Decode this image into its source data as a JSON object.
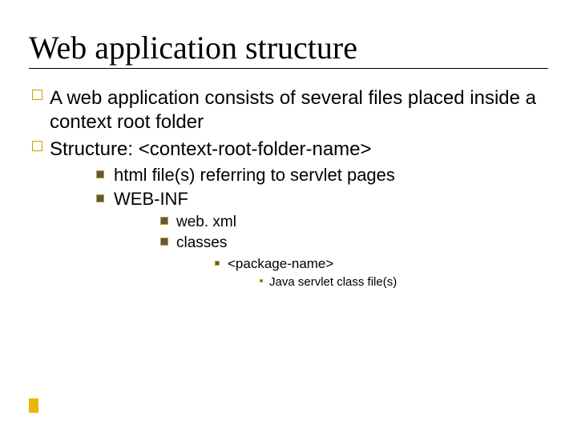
{
  "title": "Web application structure",
  "l1": [
    "A web application consists of several files placed inside a context root folder",
    "Structure: <context-root-folder-name>"
  ],
  "l2": [
    "html file(s) referring to servlet pages",
    "WEB-INF"
  ],
  "l3": [
    "web. xml",
    "classes"
  ],
  "l4": [
    "<package-name>"
  ],
  "l5": [
    "Java servlet class file(s)"
  ]
}
